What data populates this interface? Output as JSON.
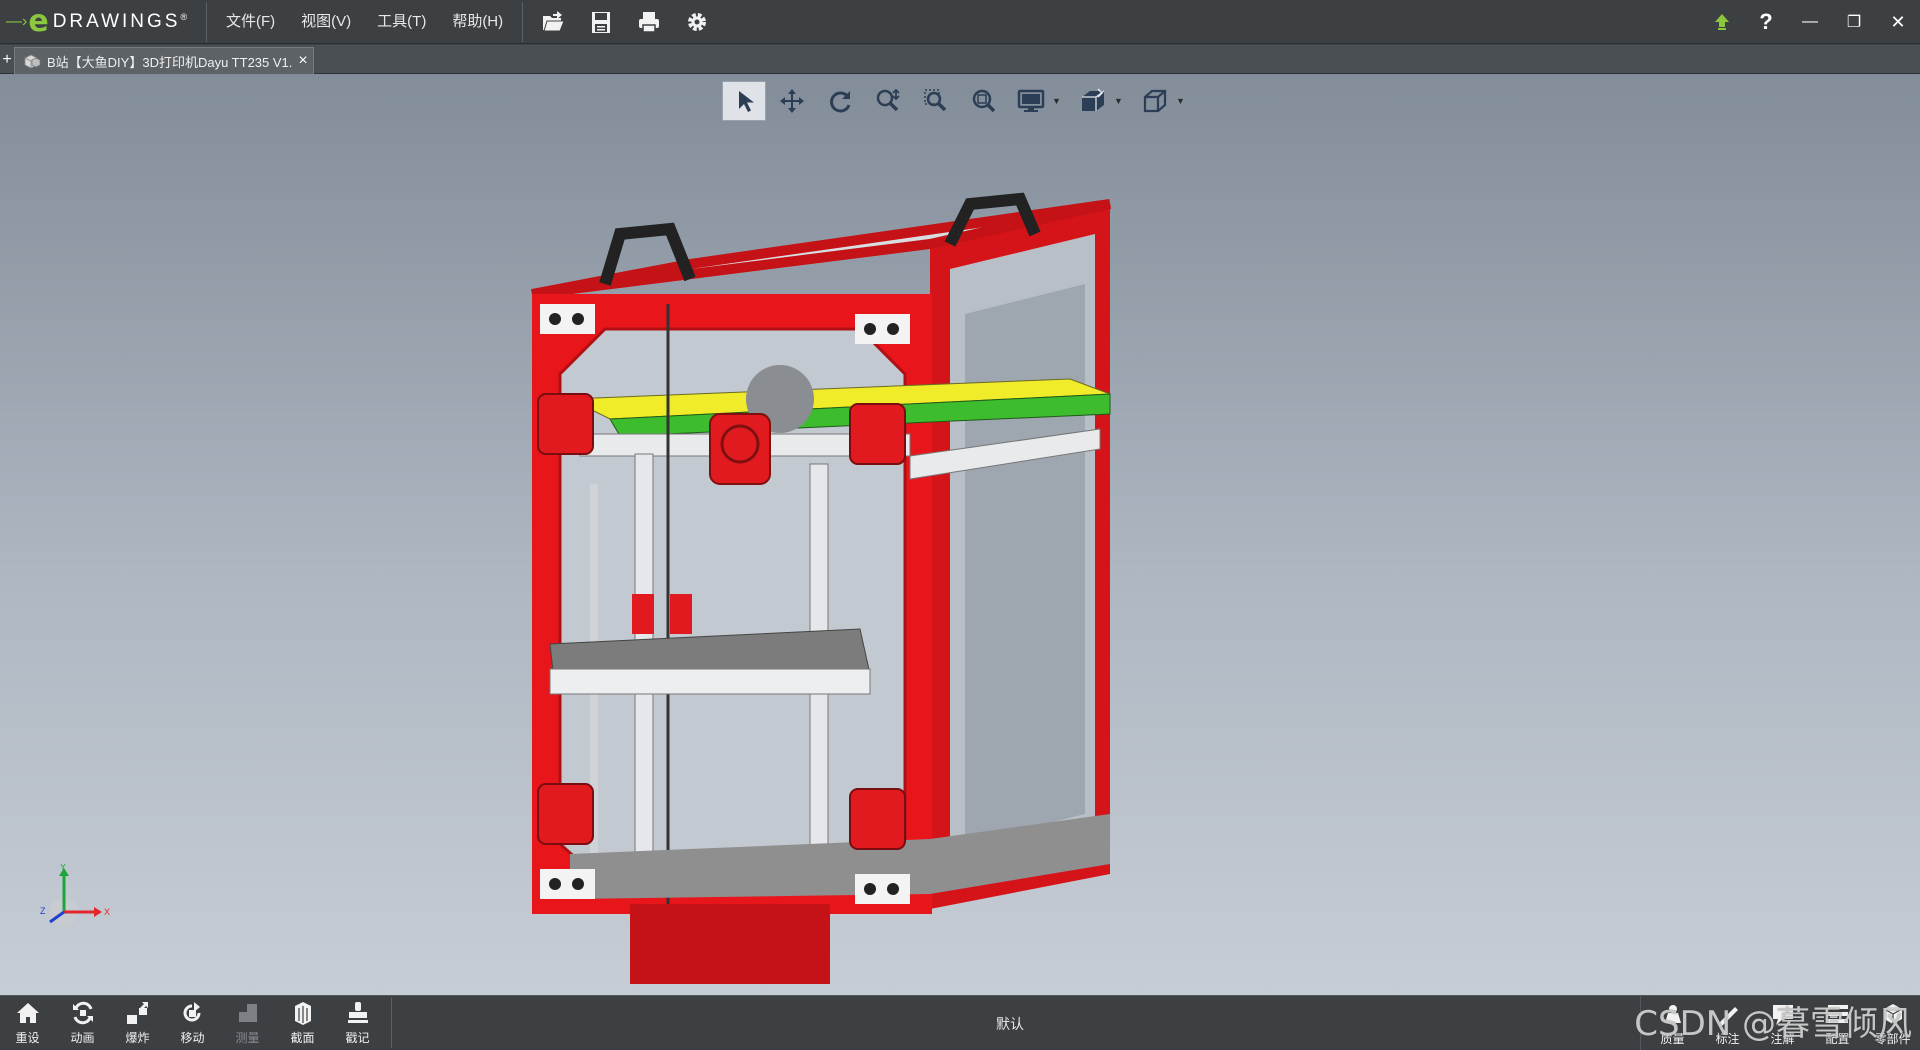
{
  "app": {
    "logo_e": "e",
    "logo_text": "DRAWINGS",
    "logo_mark": "®"
  },
  "menu": [
    {
      "label": "文件(F)"
    },
    {
      "label": "视图(V)"
    },
    {
      "label": "工具(T)"
    },
    {
      "label": "帮助(H)"
    }
  ],
  "toolbar_icons": [
    "open-folder-icon",
    "save-icon",
    "print-icon",
    "gear-icon"
  ],
  "window_controls": {
    "minimize": "—",
    "restore": "❐",
    "close": "✕"
  },
  "tabs": {
    "add": "+",
    "document": {
      "label": "B站【大鱼DIY】3D打印机Dayu TT235 V1....",
      "close": "×"
    }
  },
  "view_toolbar": [
    {
      "name": "select-icon",
      "active": true
    },
    {
      "name": "pan-icon"
    },
    {
      "name": "rotate-icon"
    },
    {
      "name": "zoom-icon"
    },
    {
      "name": "zoom-to-area-icon"
    },
    {
      "name": "zoom-to-fit-icon"
    },
    {
      "name": "display-style-icon",
      "dropdown": true
    },
    {
      "name": "views-icon",
      "dropdown": true
    },
    {
      "name": "standard-views-icon",
      "dropdown": true
    }
  ],
  "triad": {
    "x": "X",
    "y": "Y",
    "z": "Z"
  },
  "bottom_tools": [
    {
      "label": "重设",
      "icon": "home-icon"
    },
    {
      "label": "动画",
      "icon": "animate-icon"
    },
    {
      "label": "爆炸",
      "icon": "explode-icon"
    },
    {
      "label": "移动",
      "icon": "move-icon"
    },
    {
      "label": "测量",
      "icon": "measure-icon",
      "disabled": true
    },
    {
      "label": "截面",
      "icon": "section-icon"
    },
    {
      "label": "戳记",
      "icon": "stamp-icon"
    }
  ],
  "config_name": "默认",
  "bottom_right_tools": [
    {
      "label": "质量"
    },
    {
      "label": "标注"
    },
    {
      "label": "注解"
    },
    {
      "label": "配置"
    },
    {
      "label": "零部件"
    }
  ],
  "watermark": "CSDN @暮雪倾风",
  "colors": {
    "accent": "#8cc63f",
    "frame_red": "#e8161b",
    "chrome": "#3c4043"
  }
}
